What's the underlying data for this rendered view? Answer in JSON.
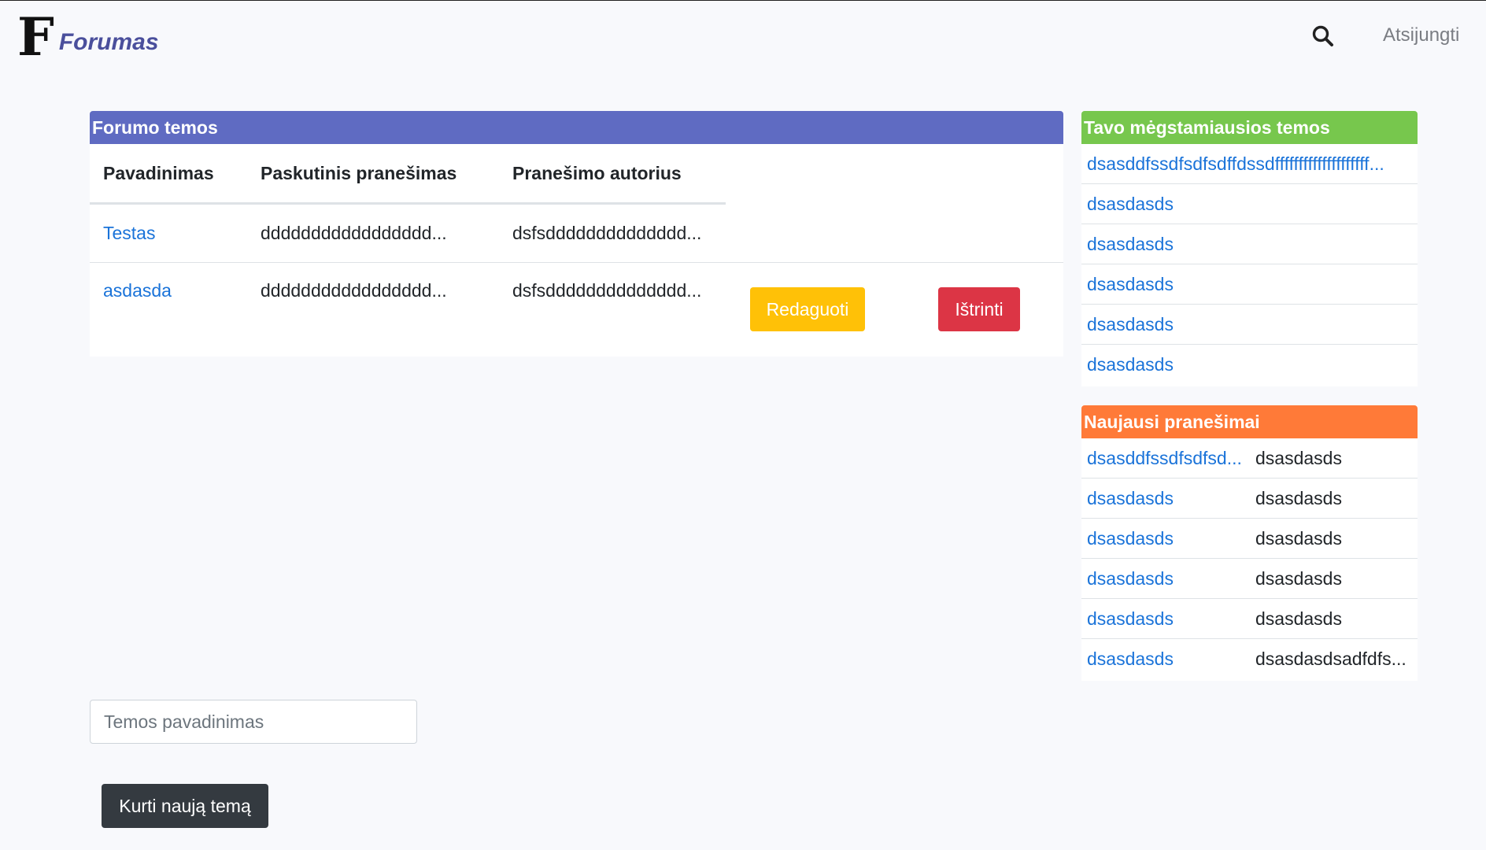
{
  "navbar": {
    "logo_letter": "F",
    "brand": "Forumas",
    "logout": "Atsijungti",
    "search_icon": "search-icon"
  },
  "topics_panel": {
    "title": "Forumo temos",
    "columns": [
      "Pavadinimas",
      "Paskutinis pranešimas",
      "Pranešimo autorius"
    ],
    "rows": [
      {
        "name": "Testas",
        "last_post": "ddddddddddddddddd...",
        "author": "dsfsdddddddddddddd..."
      },
      {
        "name": "asdasda",
        "last_post": "ddddddddddddddddd...",
        "author": "dsfsdddddddddddddd..."
      }
    ],
    "edit_label": "Redaguoti",
    "delete_label": "Ištrinti"
  },
  "favorites_panel": {
    "title": "Tavo mėgstamiausios temos",
    "items": [
      "dsasddfssdfsdfsdffdssdffffffffffffffffffff...",
      "dsasdasds",
      "dsasdasds",
      "dsasdasds",
      "dsasdasds",
      "dsasdasds"
    ]
  },
  "news_panel": {
    "title": "Naujausi pranešimai",
    "items": [
      {
        "topic": "dsasddfssdfsdfsd...",
        "author": "dsasdasds"
      },
      {
        "topic": "dsasdasds",
        "author": "dsasdasds"
      },
      {
        "topic": "dsasdasds",
        "author": "dsasdasds"
      },
      {
        "topic": "dsasdasds",
        "author": "dsasdasds"
      },
      {
        "topic": "dsasdasds",
        "author": "dsasdasds"
      },
      {
        "topic": "dsasdasds",
        "author": "dsasdasdsadfdfs..."
      }
    ]
  },
  "new_topic_form": {
    "placeholder": "Temos pavadinimas",
    "value": "",
    "submit_label": "Kurti naują temą"
  },
  "colors": {
    "topics_header": "#5f6bc2",
    "favorites_header": "#77c74d",
    "news_header": "#ff7a38",
    "edit_button": "#ffc107",
    "delete_button": "#dc3545",
    "create_button": "#343a40",
    "link": "#1a73d9"
  }
}
